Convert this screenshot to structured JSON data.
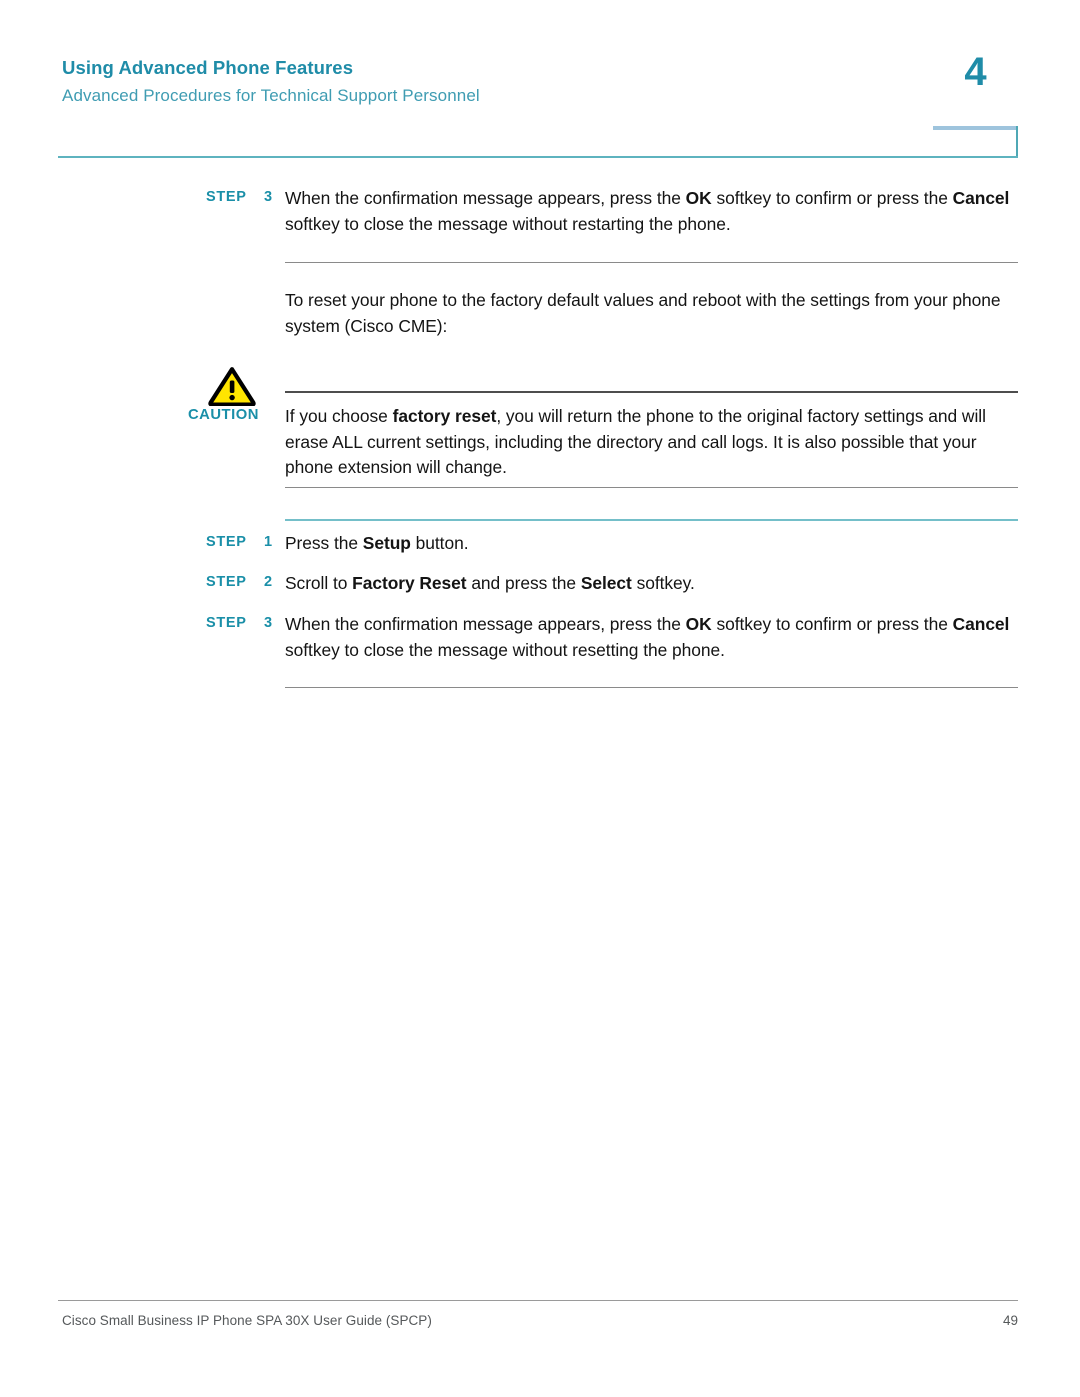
{
  "header": {
    "title": "Using Advanced Phone Features",
    "subtitle": "Advanced Procedures for Technical Support Personnel",
    "chapter_number": "4",
    "accent_color": "#1f8ca8",
    "subtitle_color": "#3f9cb2",
    "rule_color": "#5eb3bf",
    "chapter_box_top_color": "#9ec4dd"
  },
  "content": {
    "step_top": {
      "label": "STEP",
      "number": "3",
      "text_html": "When the confirmation message appears, press the <b>OK</b> softkey to confirm or press the <b>Cancel</b> softkey to close the message without restarting the phone."
    },
    "intro_paragraph": "To reset your phone to the factory default values and reboot with the settings from your phone system (Cisco CME):",
    "caution": {
      "icon": "warning-triangle-icon",
      "icon_fill": "#ffe500",
      "icon_stroke": "#000000",
      "label": "CAUTION",
      "label_color": "#1a8fa8",
      "text_html": "If you choose <b>factory reset</b>, you will return the phone to the original factory settings and will erase ALL current settings, including the directory and call logs. It is also possible that your phone extension will change."
    },
    "steps": [
      {
        "label": "STEP",
        "number": "1",
        "text_html": "Press the <b>Setup</b> button."
      },
      {
        "label": "STEP",
        "number": "2",
        "text_html": "Scroll to <b>Factory Reset</b> and press the <b>Select</b> softkey."
      },
      {
        "label": "STEP",
        "number": "3",
        "text_html": "When the confirmation message appears, press the <b>OK</b> softkey to confirm or press the <b>Cancel</b> softkey to close the message without resetting the phone."
      }
    ]
  },
  "footer": {
    "document_title": "Cisco Small Business IP Phone SPA 30X User Guide (SPCP)",
    "page_number": "49"
  }
}
